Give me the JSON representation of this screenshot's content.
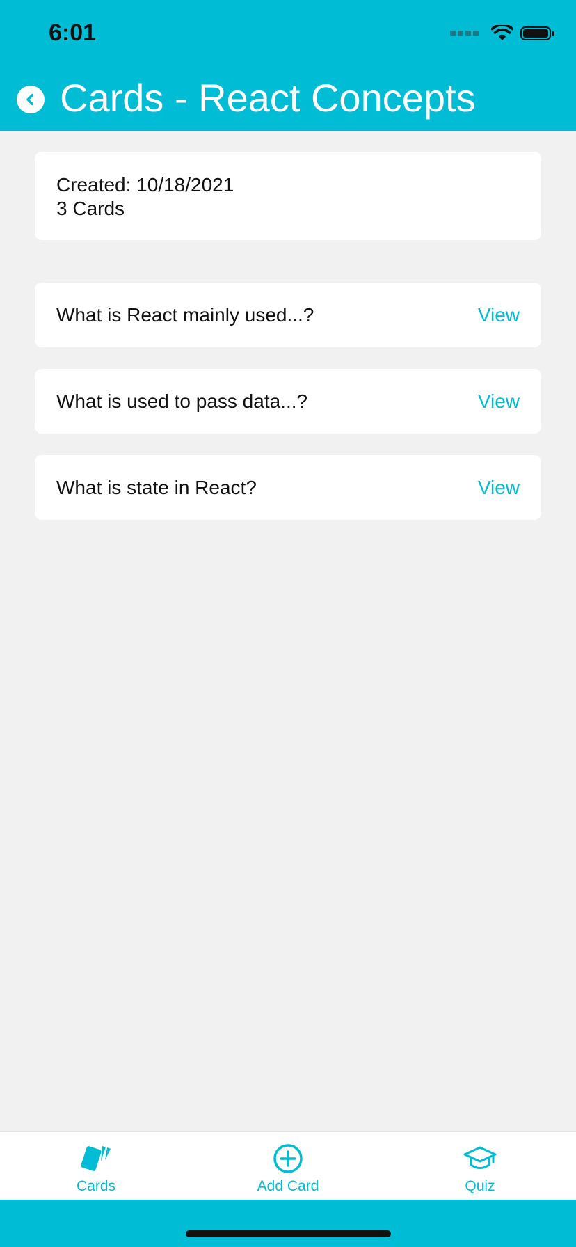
{
  "status_bar": {
    "time": "6:01"
  },
  "header": {
    "title": "Cards - React Concepts"
  },
  "deck_info": {
    "created": "Created: 10/18/2021",
    "count": "3 Cards"
  },
  "cards": [
    {
      "question": "What is React mainly used...?",
      "action": "View"
    },
    {
      "question": "What is used to pass data...?",
      "action": "View"
    },
    {
      "question": "What is state in React?",
      "action": "View"
    }
  ],
  "tabs": [
    {
      "label": "Cards",
      "icon": "cards-icon"
    },
    {
      "label": "Add Card",
      "icon": "plus-circle-icon"
    },
    {
      "label": "Quiz",
      "icon": "graduation-cap-icon"
    }
  ],
  "colors": {
    "accent": "#00bcd4",
    "background": "#f1f1f1",
    "card": "#ffffff"
  }
}
